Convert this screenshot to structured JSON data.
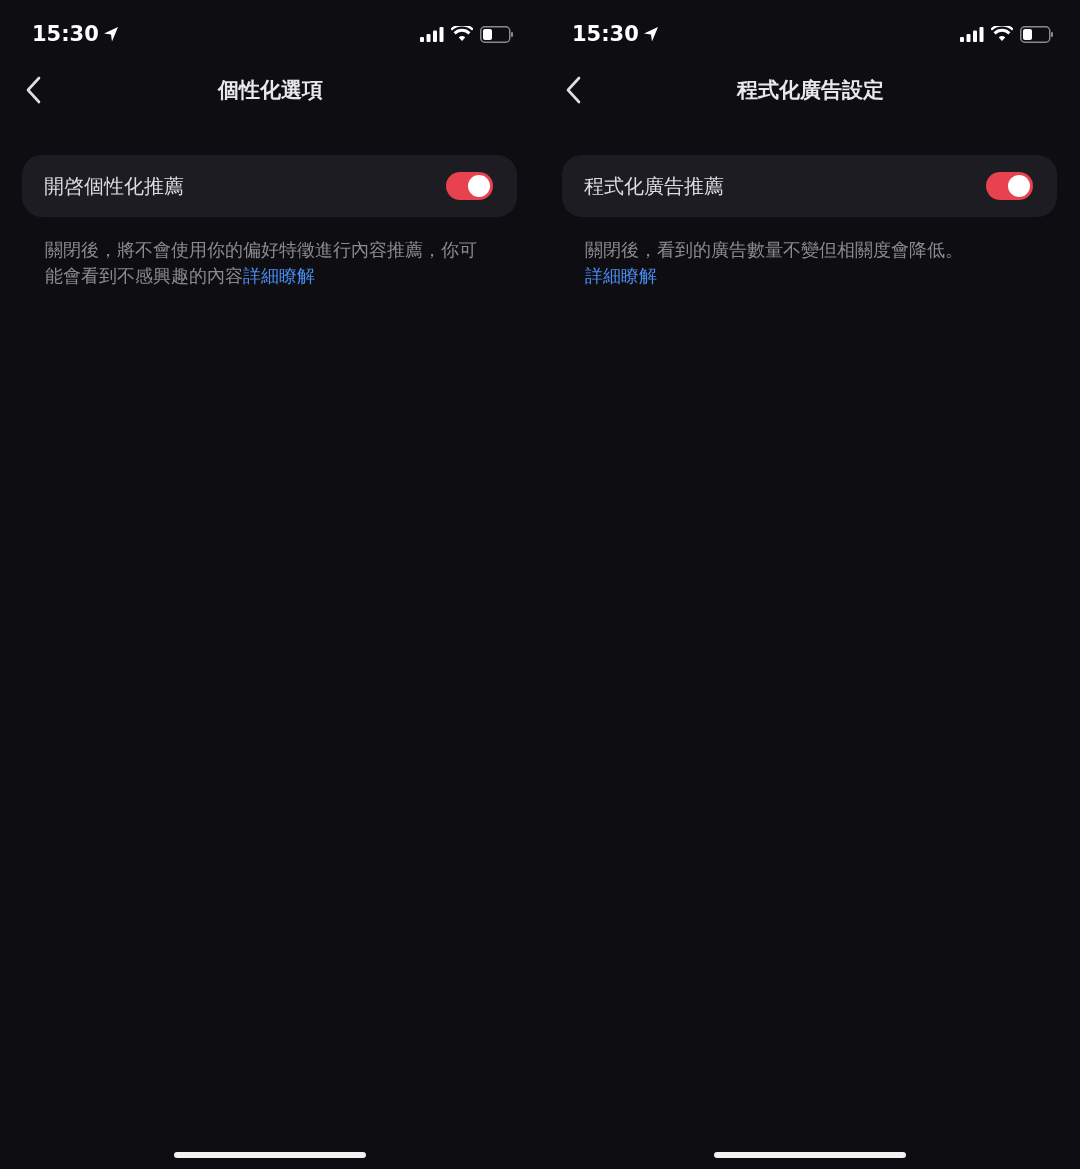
{
  "screens": [
    {
      "status_bar": {
        "time": "15:30"
      },
      "title": "個性化選項",
      "setting": {
        "label": "開啓個性化推薦",
        "on": true
      },
      "description": "關閉後，將不會使用你的偏好特徵進行內容推薦，你可能會看到不感興趣的內容",
      "link": "詳細瞭解"
    },
    {
      "status_bar": {
        "time": "15:30"
      },
      "title": "程式化廣告設定",
      "setting": {
        "label": "程式化廣告推薦",
        "on": true
      },
      "description": "關閉後，看到的廣告數量不變但相關度會降低。",
      "link": "詳細瞭解"
    }
  ]
}
